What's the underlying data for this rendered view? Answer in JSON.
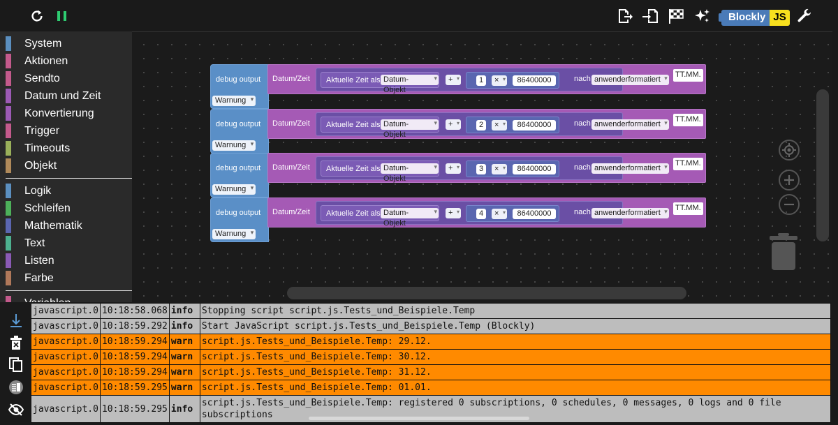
{
  "toolbar": {
    "reload_icon": "reload-icon",
    "pause_icon": "pause-icon",
    "badge_blockly": "Blockly",
    "badge_js": "JS"
  },
  "toolbox": {
    "group1": [
      {
        "label": "System",
        "color": "#5b8fbf"
      },
      {
        "label": "Aktionen",
        "color": "#c35a8c"
      },
      {
        "label": "Sendto",
        "color": "#c35a8c"
      },
      {
        "label": "Datum und Zeit",
        "color": "#9c5ab5"
      },
      {
        "label": "Konvertierung",
        "color": "#9c5ab5"
      },
      {
        "label": "Trigger",
        "color": "#c35a8c"
      },
      {
        "label": "Timeouts",
        "color": "#9ab05a"
      },
      {
        "label": "Objekt",
        "color": "#b08a5a"
      }
    ],
    "group2": [
      {
        "label": "Logik",
        "color": "#5b8fbf"
      },
      {
        "label": "Schleifen",
        "color": "#4db05a"
      },
      {
        "label": "Mathematik",
        "color": "#5b66b0"
      },
      {
        "label": "Text",
        "color": "#4db08f"
      },
      {
        "label": "Listen",
        "color": "#8a5ab5"
      },
      {
        "label": "Farbe",
        "color": "#b0785a"
      }
    ],
    "cut_label": "Variablen"
  },
  "blocks": [
    {
      "head": "debug output",
      "level": "Warnung",
      "date_label": "Datum/Zeit",
      "now_label": "Aktuelle Zeit als",
      "now_fmt": "Datum-Objekt",
      "plus": "+",
      "n": "1",
      "times": "×",
      "ms": "86400000",
      "nach": "nach",
      "fmt": "anwenderformatiert",
      "pattern": "TT.MM."
    },
    {
      "head": "debug output",
      "level": "Warnung",
      "date_label": "Datum/Zeit",
      "now_label": "Aktuelle Zeit als",
      "now_fmt": "Datum-Objekt",
      "plus": "+",
      "n": "2",
      "times": "×",
      "ms": "86400000",
      "nach": "nach",
      "fmt": "anwenderformatiert",
      "pattern": "TT.MM."
    },
    {
      "head": "debug output",
      "level": "Warnung",
      "date_label": "Datum/Zeit",
      "now_label": "Aktuelle Zeit als",
      "now_fmt": "Datum-Objekt",
      "plus": "+",
      "n": "3",
      "times": "×",
      "ms": "86400000",
      "nach": "nach",
      "fmt": "anwenderformatiert",
      "pattern": "TT.MM."
    },
    {
      "head": "debug output",
      "level": "Warnung",
      "date_label": "Datum/Zeit",
      "now_label": "Aktuelle Zeit als",
      "now_fmt": "Datum-Objekt",
      "plus": "+",
      "n": "4",
      "times": "×",
      "ms": "86400000",
      "nach": "nach",
      "fmt": "anwenderformatiert",
      "pattern": "TT.MM."
    }
  ],
  "log": {
    "rows": [
      {
        "src": "javascript.0",
        "time": "10:18:58.068",
        "sev": "info",
        "msg": "Stopping script script.js.Tests_und_Beispiele.Temp",
        "type": "info"
      },
      {
        "src": "javascript.0",
        "time": "10:18:59.292",
        "sev": "info",
        "msg": "Start JavaScript script.js.Tests_und_Beispiele.Temp (Blockly)",
        "type": "info"
      },
      {
        "src": "javascript.0",
        "time": "10:18:59.294",
        "sev": "warn",
        "msg": "script.js.Tests_und_Beispiele.Temp: 29.12.",
        "type": "warn"
      },
      {
        "src": "javascript.0",
        "time": "10:18:59.294",
        "sev": "warn",
        "msg": "script.js.Tests_und_Beispiele.Temp: 30.12.",
        "type": "warn"
      },
      {
        "src": "javascript.0",
        "time": "10:18:59.294",
        "sev": "warn",
        "msg": "script.js.Tests_und_Beispiele.Temp: 31.12.",
        "type": "warn"
      },
      {
        "src": "javascript.0",
        "time": "10:18:59.295",
        "sev": "warn",
        "msg": "script.js.Tests_und_Beispiele.Temp: 01.01.",
        "type": "warn"
      },
      {
        "src": "javascript.0",
        "time": "10:18:59.295",
        "sev": "info",
        "msg": "script.js.Tests_und_Beispiele.Temp: registered 0 subscriptions, 0 schedules, 0 messages, 0 logs and 0 file subscriptions",
        "type": "info"
      }
    ]
  },
  "colors": {
    "warn": "#ff8a00",
    "info": "#bdbdbd",
    "pause": "#2ecc71",
    "debug_block": "#5a8fc7",
    "date_block": "#a55ab5"
  }
}
